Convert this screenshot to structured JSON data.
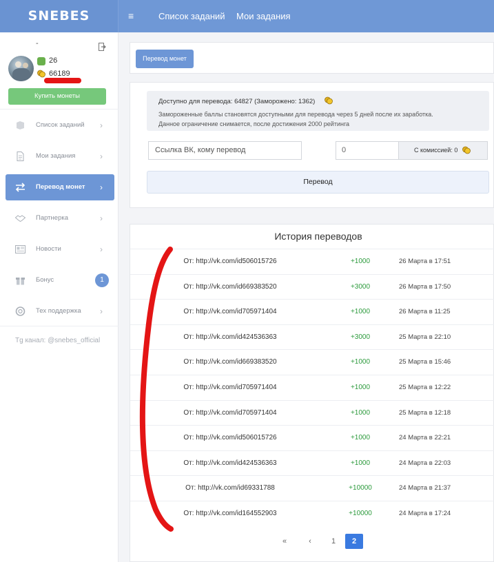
{
  "brand": "SNEBES",
  "nav": {
    "menu_icon": "≡",
    "tasks_list": "Список заданий",
    "my_tasks": "Мои задания"
  },
  "profile": {
    "name_placeholder": "-",
    "rating": "26",
    "coins": "66189",
    "buy_label": "Купить монеты"
  },
  "sidebar": {
    "items": [
      {
        "label": "Список заданий",
        "icon": "globe-icon"
      },
      {
        "label": "Мои задания",
        "icon": "document-icon"
      },
      {
        "label": "Перевод монет",
        "icon": "transfer-icon",
        "active": true
      },
      {
        "label": "Партнерка",
        "icon": "handshake-icon"
      },
      {
        "label": "Новости",
        "icon": "newspaper-icon"
      },
      {
        "label": "Бонус",
        "icon": "gift-icon",
        "badge": "1"
      },
      {
        "label": "Тех поддержка",
        "icon": "lifebuoy-icon"
      }
    ],
    "chevron": "›",
    "telegram": "Tg канал: @snebes_official"
  },
  "transfer": {
    "tab_label": "Перевод монет",
    "available_text": "Доступно для перевода: 64827 (Заморожено: 1362)",
    "note_1": "Замороженные баллы становятся доступными для перевода через 5 дней после их заработка.",
    "note_2": "Данное ограничение снимается, после достижения 2000 рейтинга",
    "vk_placeholder": "Ссылка ВК, кому перевод",
    "amount_value": "0",
    "commission_text": "С комиссией: 0",
    "submit_label": "Перевод"
  },
  "history": {
    "title": "История переводов",
    "rows": [
      {
        "from": "От: http://vk.com/id506015726",
        "amount": "+1000",
        "date": "26 Марта в 17:51"
      },
      {
        "from": "От: http://vk.com/id669383520",
        "amount": "+3000",
        "date": "26 Марта в 17:50"
      },
      {
        "from": "От: http://vk.com/id705971404",
        "amount": "+1000",
        "date": "26 Марта в 11:25"
      },
      {
        "from": "От: http://vk.com/id424536363",
        "amount": "+3000",
        "date": "25 Марта в 22:10"
      },
      {
        "from": "От: http://vk.com/id669383520",
        "amount": "+1000",
        "date": "25 Марта в 15:46"
      },
      {
        "from": "От: http://vk.com/id705971404",
        "amount": "+1000",
        "date": "25 Марта в 12:22"
      },
      {
        "from": "От: http://vk.com/id705971404",
        "amount": "+1000",
        "date": "25 Марта в 12:18"
      },
      {
        "from": "От: http://vk.com/id506015726",
        "amount": "+1000",
        "date": "24 Марта в 22:21"
      },
      {
        "from": "От: http://vk.com/id424536363",
        "amount": "+1000",
        "date": "24 Марта в 22:03"
      },
      {
        "from": "От: http://vk.com/id69331788",
        "amount": "+10000",
        "date": "24 Марта в 21:37"
      },
      {
        "from": "От: http://vk.com/id164552903",
        "amount": "+10000",
        "date": "24 Марта в 17:24"
      }
    ]
  },
  "pagination": {
    "first": "«",
    "prev": "‹",
    "page_1": "1",
    "page_2": "2",
    "current": "2"
  },
  "colors": {
    "accent": "#6d96d6",
    "success": "#76c87b",
    "positive_amount": "#2c9a3c",
    "annotation": "#e41515"
  }
}
